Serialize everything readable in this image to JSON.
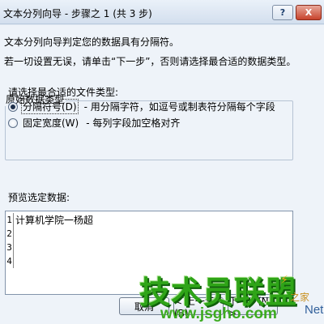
{
  "window": {
    "title": "文本分列向导 - 步骤之 1 (共 3 步)",
    "help_label": "?",
    "close_label": "X"
  },
  "intro": {
    "line1": "文本分列向导判定您的数据具有分隔符。",
    "line2": "若一切设置无误，请单击“下一步”，否则请选择最合适的数据类型。"
  },
  "original_type": {
    "group_label": "原始数据类型",
    "prompt": "请选择最合适的文件类型:",
    "options": [
      {
        "label": "分隔符号(D)",
        "description": "- 用分隔字符，如逗号或制表符分隔每个字段",
        "selected": true
      },
      {
        "label": "固定宽度(W)",
        "description": "- 每列字段加空格对齐",
        "selected": false
      }
    ]
  },
  "preview": {
    "label": "预览选定数据:",
    "rows": [
      {
        "num": "1",
        "text": "计算机学院一杨超"
      },
      {
        "num": "2",
        "text": ""
      },
      {
        "num": "3",
        "text": ""
      },
      {
        "num": "4",
        "text": ""
      }
    ]
  },
  "buttons": {
    "cancel": "取消",
    "back": "< 上一步(B)",
    "next": "下一步(N) >"
  },
  "watermark": {
    "main": "技术员联盟",
    "url": "www.jsgho.com",
    "tag1": "之家",
    "tag2": "Net"
  },
  "colors": {
    "titlebar": "#d3dfee",
    "client": "#eef3f9",
    "close_button": "#c7432c",
    "watermark_green": "#2fa418"
  }
}
